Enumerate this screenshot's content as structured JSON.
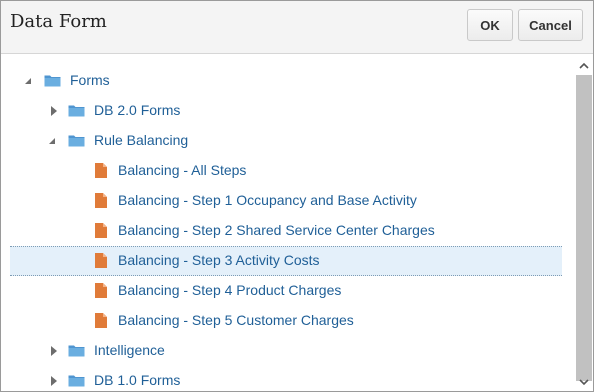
{
  "dialog": {
    "title": "Data Form",
    "ok_label": "OK",
    "cancel_label": "Cancel"
  },
  "tree": {
    "items": [
      {
        "label": "Forms",
        "type": "folder",
        "level": 0,
        "expanded": true
      },
      {
        "label": "DB 2.0 Forms",
        "type": "folder",
        "level": 1,
        "expanded": false
      },
      {
        "label": "Rule Balancing",
        "type": "folder",
        "level": 1,
        "expanded": true
      },
      {
        "label": "Balancing - All Steps",
        "type": "form",
        "level": 2
      },
      {
        "label": "Balancing - Step 1 Occupancy and Base Activity",
        "type": "form",
        "level": 2
      },
      {
        "label": "Balancing - Step 2 Shared Service Center Charges",
        "type": "form",
        "level": 2
      },
      {
        "label": "Balancing - Step 3 Activity Costs",
        "type": "form",
        "level": 2,
        "selected": true
      },
      {
        "label": "Balancing - Step 4 Product Charges",
        "type": "form",
        "level": 2
      },
      {
        "label": "Balancing - Step 5 Customer Charges",
        "type": "form",
        "level": 2
      },
      {
        "label": "Intelligence",
        "type": "folder",
        "level": 1,
        "expanded": false
      },
      {
        "label": "DB 1.0 Forms",
        "type": "folder",
        "level": 1,
        "expanded": false
      }
    ]
  },
  "colors": {
    "link_text": "#1f5f97",
    "folder": "#4f95d0",
    "form_icon": "#e07b39",
    "selected_row": "#e4f0fa"
  }
}
